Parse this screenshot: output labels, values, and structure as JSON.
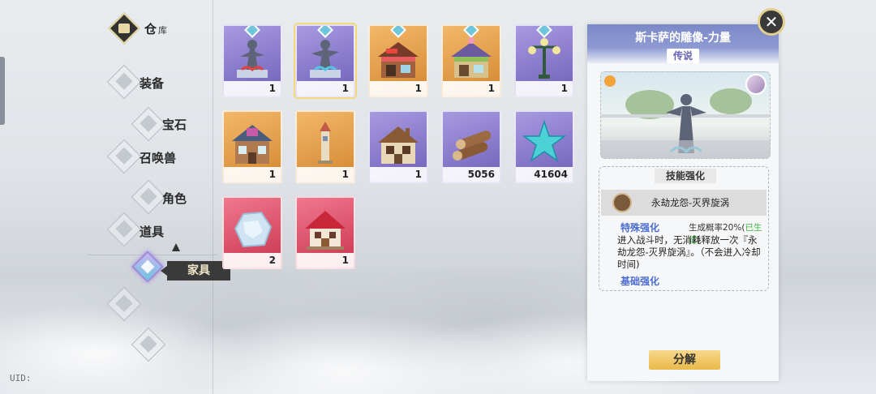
{
  "nav": {
    "title": "仓",
    "title_sub": "库",
    "items": [
      {
        "label": "装备"
      },
      {
        "label": "宝石"
      },
      {
        "label": "召唤兽"
      },
      {
        "label": "角色"
      },
      {
        "label": "道具"
      },
      {
        "label": "家具"
      }
    ],
    "selected": "家具",
    "uid": "UID:"
  },
  "inventory": {
    "items": [
      {
        "icon": "statue-icon",
        "count": "1",
        "rarity": "purple"
      },
      {
        "icon": "statue-icon",
        "count": "1",
        "rarity": "purple"
      },
      {
        "icon": "shop-icon",
        "count": "1",
        "rarity": "orange"
      },
      {
        "icon": "flower-shop-icon",
        "count": "1",
        "rarity": "orange"
      },
      {
        "icon": "lamp-post-icon",
        "count": "1",
        "rarity": "purple"
      },
      {
        "icon": "house-icon",
        "count": "1",
        "rarity": "orange"
      },
      {
        "icon": "tower-icon",
        "count": "1",
        "rarity": "orange"
      },
      {
        "icon": "cottage-icon",
        "count": "1",
        "rarity": "purple"
      },
      {
        "icon": "wood-logs-icon",
        "count": "5056",
        "rarity": "purple"
      },
      {
        "icon": "star-icon",
        "count": "41604",
        "rarity": "purple"
      },
      {
        "icon": "ice-crystal-icon",
        "count": "2",
        "rarity": "red"
      },
      {
        "icon": "red-house-icon",
        "count": "1",
        "rarity": "red"
      }
    ]
  },
  "detail": {
    "title": "斯卡萨的雕像-力量",
    "rarity": "传说",
    "skill_tag": "技能强化",
    "skill_name": "永劫龙怨-灭界旋涡",
    "special_label": "特殊强化",
    "gen_rate_prefix": "生成概率20%(",
    "gen_rate_status": "已生成",
    "gen_rate_suffix": ")",
    "description": "进入战斗时，无消耗释放一次『永劫龙怨-灭界旋涡』。（不会进入冷却时间)",
    "base_label": "基础强化",
    "decompose_label": "分解",
    "close_label": "✕"
  },
  "colors": {
    "purple_rarity": "#7d6fc8",
    "orange_rarity": "#e09a45",
    "red_rarity": "#d9475f",
    "accent_gold": "#e2cf8e",
    "link_blue": "#4d6dd0",
    "generated_green": "#3eb73e"
  }
}
